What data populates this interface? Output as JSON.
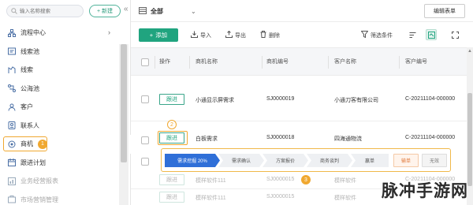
{
  "sidebar": {
    "search_placeholder": "输入名称搜索",
    "new_label": "新建",
    "collapse_glyph": "«",
    "items": [
      {
        "label": "流程中心",
        "icon": "org-icon",
        "has_chevron": true
      },
      {
        "label": "线索池",
        "icon": "pool-icon"
      },
      {
        "label": "线索",
        "icon": "clue-icon"
      },
      {
        "label": "公海池",
        "icon": "sea-icon"
      },
      {
        "label": "客户",
        "icon": "customer-icon"
      },
      {
        "label": "联系人",
        "icon": "contact-icon"
      },
      {
        "label": "商机",
        "icon": "opportunity-icon",
        "active": true,
        "badge": "1"
      },
      {
        "label": "跟进计划",
        "icon": "plan-icon"
      },
      {
        "label": "业务经营报表",
        "icon": "report-icon",
        "faded": true
      },
      {
        "label": "市场营销管理",
        "icon": "marketing-icon",
        "faded": true
      }
    ]
  },
  "topbar": {
    "view_label": "全部",
    "edit_table_label": "编辑表单"
  },
  "toolbar": {
    "add_label": "添加",
    "import_label": "导入",
    "export_label": "导出",
    "delete_label": "删除",
    "filter_label": "筛选条件"
  },
  "table": {
    "headers": [
      "操作",
      "商机名称",
      "商机编号",
      "客户名称",
      "客户编号"
    ],
    "follow_label": "跟进",
    "rows": [
      {
        "name": "小通显示屏需求",
        "code": "SJ0000019",
        "customer": "小通刀客有限公司",
        "customer_code": "C-20211104-000000"
      },
      {
        "name": "白板需求",
        "code": "SJ0000018",
        "customer": "四海通物流",
        "customer_code": "C-20211104-000000"
      },
      {
        "name": "模样软件111",
        "code": "SJ0000015",
        "customer": "模样软件",
        "customer_code": "C-20211104-000000"
      },
      {
        "name": "模样软件111",
        "code": "SJ0000015",
        "customer": "模样软件",
        "customer_code": "C-20211104-000000"
      }
    ]
  },
  "callouts": {
    "two": "2",
    "three": "3"
  },
  "stages": [
    {
      "label": "需求挖掘 20%",
      "active": true
    },
    {
      "label": "需求确认"
    },
    {
      "label": "方案报价"
    },
    {
      "label": "商务谈判"
    },
    {
      "label": "赢单"
    },
    {
      "label": "输单",
      "kind": "lose"
    },
    {
      "label": "无效",
      "kind": "invalid"
    }
  ],
  "colors": {
    "accent": "#20a47f",
    "highlight": "#f0a830",
    "stage_active": "#2f6fd8"
  },
  "watermark": "脉冲手游网"
}
